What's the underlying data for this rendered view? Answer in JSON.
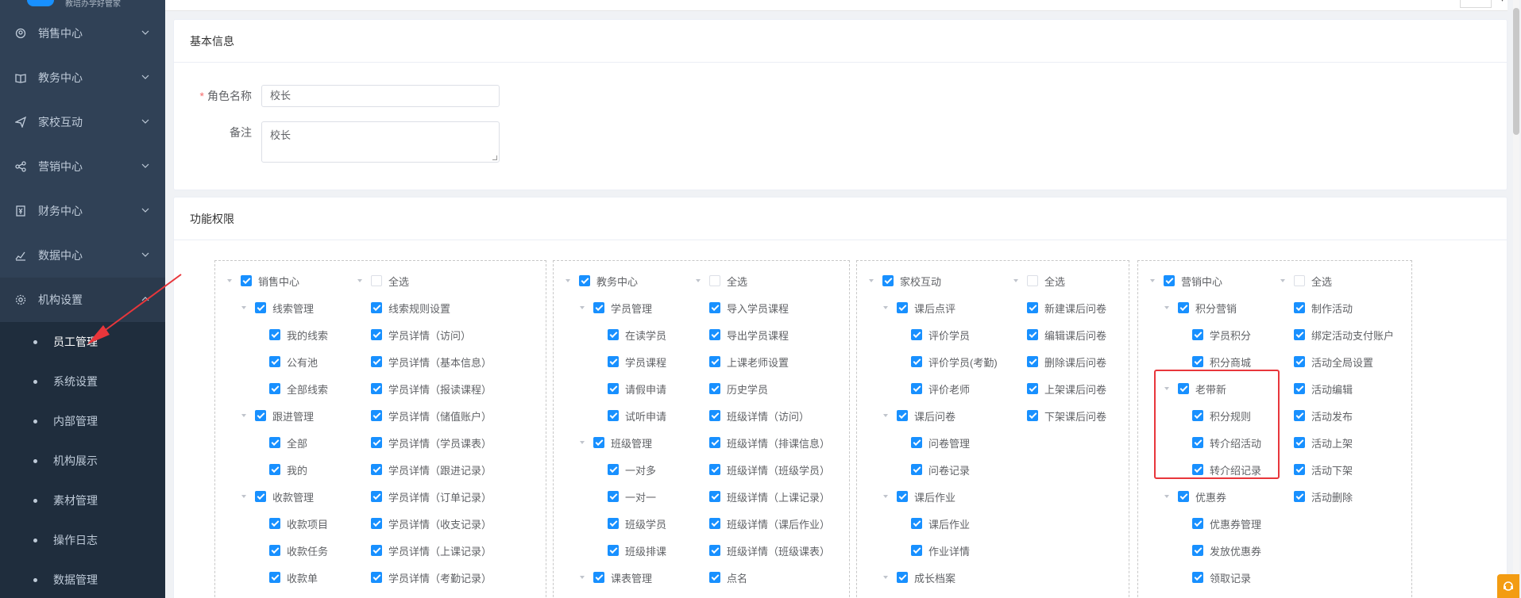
{
  "sidebar": {
    "logo_text": "教培办学好管家",
    "menu": [
      {
        "label": "销售中心",
        "icon": "user-target-icon"
      },
      {
        "label": "教务中心",
        "icon": "book-icon"
      },
      {
        "label": "家校互动",
        "icon": "paper-plane-icon"
      },
      {
        "label": "营销中心",
        "icon": "share-icon"
      },
      {
        "label": "财务中心",
        "icon": "finance-icon"
      },
      {
        "label": "数据中心",
        "icon": "chart-icon"
      },
      {
        "label": "机构设置",
        "icon": "gear-icon"
      }
    ],
    "submenu": [
      "员工管理",
      "系统设置",
      "内部管理",
      "机构展示",
      "素材管理",
      "操作日志",
      "数据管理"
    ],
    "active_sub": "员工管理"
  },
  "basic_info": {
    "title": "基本信息",
    "role_label": "角色名称",
    "role_value": "校长",
    "remark_label": "备注",
    "remark_value": "校长"
  },
  "permissions": {
    "title": "功能权限",
    "select_all": "全选",
    "panels": [
      {
        "root": "销售中心",
        "col1": [
          {
            "t": "线索管理",
            "lvl": 1,
            "on": true
          },
          {
            "t": "我的线索",
            "lvl": 2,
            "on": true
          },
          {
            "t": "公有池",
            "lvl": 2,
            "on": true
          },
          {
            "t": "全部线索",
            "lvl": 2,
            "on": true
          },
          {
            "t": "跟进管理",
            "lvl": 1,
            "on": true
          },
          {
            "t": "全部",
            "lvl": 2,
            "on": true
          },
          {
            "t": "我的",
            "lvl": 2,
            "on": true
          },
          {
            "t": "收款管理",
            "lvl": 1,
            "on": true
          },
          {
            "t": "收款项目",
            "lvl": 2,
            "on": true
          },
          {
            "t": "收款任务",
            "lvl": 2,
            "on": true
          },
          {
            "t": "收款单",
            "lvl": 2,
            "on": true
          }
        ],
        "col2": [
          "线索规则设置",
          "学员详情（访问）",
          "学员详情（基本信息）",
          "学员详情（报读课程）",
          "学员详情（储值账户）",
          "学员详情（学员课表）",
          "学员详情（跟进记录）",
          "学员详情（订单记录）",
          "学员详情（收支记录）",
          "学员详情（上课记录）",
          "学员详情（考勤记录）"
        ]
      },
      {
        "root": "教务中心",
        "col1": [
          {
            "t": "学员管理",
            "lvl": 1,
            "on": true
          },
          {
            "t": "在读学员",
            "lvl": 2,
            "on": true
          },
          {
            "t": "学员课程",
            "lvl": 2,
            "on": true
          },
          {
            "t": "请假申请",
            "lvl": 2,
            "on": true
          },
          {
            "t": "试听申请",
            "lvl": 2,
            "on": true
          },
          {
            "t": "班级管理",
            "lvl": 1,
            "on": true
          },
          {
            "t": "一对多",
            "lvl": 2,
            "on": true
          },
          {
            "t": "一对一",
            "lvl": 2,
            "on": true
          },
          {
            "t": "班级学员",
            "lvl": 2,
            "on": true
          },
          {
            "t": "班级排课",
            "lvl": 2,
            "on": true
          },
          {
            "t": "课表管理",
            "lvl": 1,
            "on": true
          }
        ],
        "col2": [
          "导入学员课程",
          "导出学员课程",
          "上课老师设置",
          "历史学员",
          "班级详情（访问）",
          "班级详情（排课信息）",
          "班级详情（班级学员）",
          "班级详情（上课记录）",
          "班级详情（课后作业）",
          "班级详情（班级课表）",
          "点名"
        ]
      },
      {
        "root": "家校互动",
        "col1": [
          {
            "t": "课后点评",
            "lvl": 1,
            "on": true
          },
          {
            "t": "评价学员",
            "lvl": 2,
            "on": true
          },
          {
            "t": "评价学员(考勤)",
            "lvl": 2,
            "on": true
          },
          {
            "t": "评价老师",
            "lvl": 2,
            "on": true
          },
          {
            "t": "课后问卷",
            "lvl": 1,
            "on": true
          },
          {
            "t": "问卷管理",
            "lvl": 2,
            "on": true
          },
          {
            "t": "问卷记录",
            "lvl": 2,
            "on": true
          },
          {
            "t": "课后作业",
            "lvl": 1,
            "on": true
          },
          {
            "t": "课后作业",
            "lvl": 2,
            "on": true
          },
          {
            "t": "作业详情",
            "lvl": 2,
            "on": true
          },
          {
            "t": "成长档案",
            "lvl": 1,
            "on": true
          }
        ],
        "col2": [
          "新建课后问卷",
          "编辑课后问卷",
          "删除课后问卷",
          "上架课后问卷",
          "下架课后问卷"
        ]
      },
      {
        "root": "营销中心",
        "col1": [
          {
            "t": "积分营销",
            "lvl": 1,
            "on": true
          },
          {
            "t": "学员积分",
            "lvl": 2,
            "on": true
          },
          {
            "t": "积分商城",
            "lvl": 2,
            "on": true
          },
          {
            "t": "老带新",
            "lvl": 1,
            "on": true
          },
          {
            "t": "积分规则",
            "lvl": 2,
            "on": true
          },
          {
            "t": "转介绍活动",
            "lvl": 2,
            "on": true
          },
          {
            "t": "转介绍记录",
            "lvl": 2,
            "on": true
          },
          {
            "t": "优惠券",
            "lvl": 1,
            "on": true
          },
          {
            "t": "优惠券管理",
            "lvl": 2,
            "on": true
          },
          {
            "t": "发放优惠券",
            "lvl": 2,
            "on": true
          },
          {
            "t": "领取记录",
            "lvl": 2,
            "on": true
          }
        ],
        "col2": [
          "制作活动",
          "绑定活动支付账户",
          "活动全局设置",
          "活动编辑",
          "活动发布",
          "活动上架",
          "活动下架",
          "活动删除"
        ]
      }
    ]
  },
  "colors": {
    "sidebar_bg": "#304156",
    "checkbox_blue": "#1890ff",
    "highlight_red": "#e8363b",
    "arrow_red": "#e8363b"
  }
}
